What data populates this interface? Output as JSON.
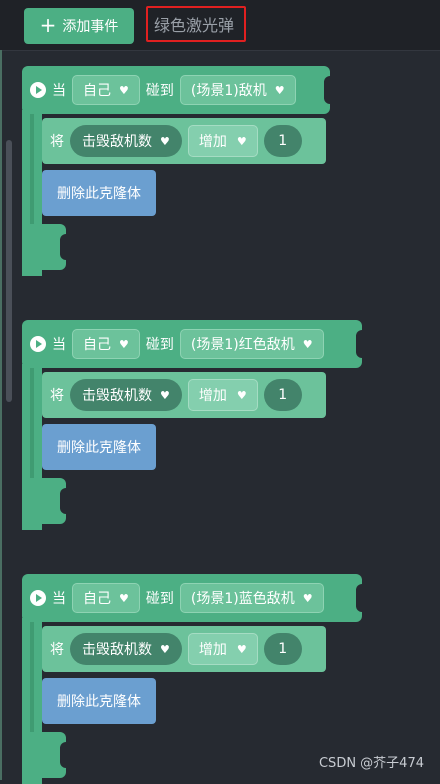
{
  "toolbar": {
    "add_event_label": "添加事件",
    "selected_object": "绿色激光弹"
  },
  "events": [
    {
      "when": "当",
      "subject": "自己",
      "trigger": "碰到",
      "target": "(场景1)敌机",
      "set_word": "将",
      "variable": "击毁敌机数",
      "operation": "增加",
      "amount": "1",
      "delete_label": "删除此克隆体"
    },
    {
      "when": "当",
      "subject": "自己",
      "trigger": "碰到",
      "target": "(场景1)红色敌机",
      "set_word": "将",
      "variable": "击毁敌机数",
      "operation": "增加",
      "amount": "1",
      "delete_label": "删除此克隆体"
    },
    {
      "when": "当",
      "subject": "自己",
      "trigger": "碰到",
      "target": "(场景1)蓝色敌机",
      "set_word": "将",
      "variable": "击毁敌机数",
      "operation": "增加",
      "amount": "1",
      "delete_label": "删除此克隆体"
    }
  ],
  "watermark": "CSDN @芥子474",
  "colors": {
    "event_block": "#4caf84",
    "statement_block": "#6cc29b",
    "control_block": "#6b9fd0",
    "highlight": "#e02020"
  }
}
